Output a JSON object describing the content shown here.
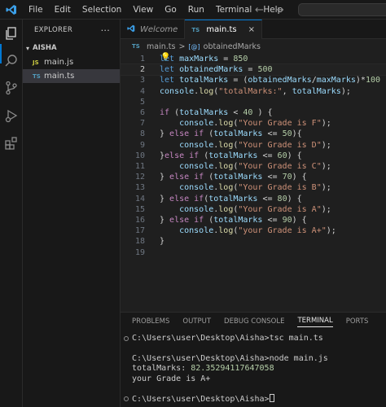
{
  "menu": [
    "File",
    "Edit",
    "Selection",
    "View",
    "Go",
    "Run",
    "Terminal",
    "Help"
  ],
  "nav": {
    "back": "←",
    "forward": "→"
  },
  "explorer": {
    "title": "EXPLORER",
    "more": "···",
    "folder": "AISHA",
    "files": [
      {
        "icon": "JS",
        "icon_color": "#cbcb41",
        "name": "main.js",
        "active": false
      },
      {
        "icon": "TS",
        "icon_color": "#519aba",
        "name": "main.ts",
        "active": true
      }
    ]
  },
  "tabs": [
    {
      "icon": "vscode-icon",
      "label": "Welcome",
      "active": false
    },
    {
      "icon": "TS",
      "label": "main.ts",
      "active": true,
      "close": "×"
    }
  ],
  "breadcrumb": {
    "file_icon": "TS",
    "file": "main.ts",
    "sep": ">",
    "symbol_icon": "[@]",
    "symbol": "obtainedMarks"
  },
  "editor": {
    "current_line": 2,
    "lines": [
      {
        "n": "1",
        "tokens": [
          [
            "kw",
            "let"
          ],
          [
            "pl",
            " "
          ],
          [
            "var",
            "maxMarks"
          ],
          [
            "pl",
            " = "
          ],
          [
            "num",
            "850"
          ]
        ]
      },
      {
        "n": "2",
        "tokens": [
          [
            "kw",
            "let"
          ],
          [
            "pl",
            " "
          ],
          [
            "var",
            "obtainedMarks"
          ],
          [
            "pl",
            " = "
          ],
          [
            "num",
            "500"
          ]
        ]
      },
      {
        "n": "3",
        "tokens": [
          [
            "kw",
            "let"
          ],
          [
            "pl",
            " "
          ],
          [
            "var",
            "totalMarks"
          ],
          [
            "pl",
            " = ("
          ],
          [
            "var",
            "obtainedMarks"
          ],
          [
            "pl",
            "/"
          ],
          [
            "var",
            "maxMarks"
          ],
          [
            "pl",
            ")*"
          ],
          [
            "num",
            "100"
          ]
        ]
      },
      {
        "n": "4",
        "tokens": [
          [
            "var",
            "console"
          ],
          [
            "pl",
            "."
          ],
          [
            "fn",
            "log"
          ],
          [
            "pl",
            "("
          ],
          [
            "str",
            "\"totalMarks:\""
          ],
          [
            "pl",
            ", "
          ],
          [
            "var",
            "totalMarks"
          ],
          [
            "pl",
            ");"
          ]
        ]
      },
      {
        "n": "5",
        "tokens": []
      },
      {
        "n": "6",
        "tokens": [
          [
            "ctl",
            "if"
          ],
          [
            "pl",
            " ("
          ],
          [
            "var",
            "totalMarks"
          ],
          [
            "pl",
            " < "
          ],
          [
            "num",
            "40"
          ],
          [
            "pl",
            " ) {"
          ]
        ]
      },
      {
        "n": "7",
        "tokens": [
          [
            "pl",
            "    "
          ],
          [
            "var",
            "console"
          ],
          [
            "pl",
            "."
          ],
          [
            "fn",
            "log"
          ],
          [
            "pl",
            "("
          ],
          [
            "str",
            "\"Your Grade is F\""
          ],
          [
            "pl",
            ");"
          ]
        ]
      },
      {
        "n": "8",
        "tokens": [
          [
            "pl",
            "} "
          ],
          [
            "ctl",
            "else if"
          ],
          [
            "pl",
            " ("
          ],
          [
            "var",
            "totalMarks"
          ],
          [
            "pl",
            " <= "
          ],
          [
            "num",
            "50"
          ],
          [
            "pl",
            "){"
          ]
        ]
      },
      {
        "n": "9",
        "tokens": [
          [
            "pl",
            "    "
          ],
          [
            "var",
            "console"
          ],
          [
            "pl",
            "."
          ],
          [
            "fn",
            "log"
          ],
          [
            "pl",
            "("
          ],
          [
            "str",
            "\"Your Grade is D\""
          ],
          [
            "pl",
            ");"
          ]
        ]
      },
      {
        "n": "10",
        "tokens": [
          [
            "pl",
            "}"
          ],
          [
            "ctl",
            "else if"
          ],
          [
            "pl",
            " ("
          ],
          [
            "var",
            "totalMarks"
          ],
          [
            "pl",
            " <= "
          ],
          [
            "num",
            "60"
          ],
          [
            "pl",
            ") {"
          ]
        ]
      },
      {
        "n": "11",
        "tokens": [
          [
            "pl",
            "    "
          ],
          [
            "var",
            "console"
          ],
          [
            "pl",
            "."
          ],
          [
            "fn",
            "log"
          ],
          [
            "pl",
            "("
          ],
          [
            "str",
            "\"Your Grade is C\""
          ],
          [
            "pl",
            ");"
          ]
        ]
      },
      {
        "n": "12",
        "tokens": [
          [
            "pl",
            "} "
          ],
          [
            "ctl",
            "else if"
          ],
          [
            "pl",
            " ("
          ],
          [
            "var",
            "totalMarks"
          ],
          [
            "pl",
            " <= "
          ],
          [
            "num",
            "70"
          ],
          [
            "pl",
            ") {"
          ]
        ]
      },
      {
        "n": "13",
        "tokens": [
          [
            "pl",
            "    "
          ],
          [
            "var",
            "console"
          ],
          [
            "pl",
            "."
          ],
          [
            "fn",
            "log"
          ],
          [
            "pl",
            "("
          ],
          [
            "str",
            "\"Your Grade is B\""
          ],
          [
            "pl",
            ");"
          ]
        ]
      },
      {
        "n": "14",
        "tokens": [
          [
            "pl",
            "} "
          ],
          [
            "ctl",
            "else if"
          ],
          [
            "pl",
            "("
          ],
          [
            "var",
            "totalMarks"
          ],
          [
            "pl",
            " <= "
          ],
          [
            "num",
            "80"
          ],
          [
            "pl",
            ") {"
          ]
        ]
      },
      {
        "n": "15",
        "tokens": [
          [
            "pl",
            "    "
          ],
          [
            "var",
            "console"
          ],
          [
            "pl",
            "."
          ],
          [
            "fn",
            "log"
          ],
          [
            "pl",
            "("
          ],
          [
            "str",
            "\"Your Grade is A\""
          ],
          [
            "pl",
            ");"
          ]
        ]
      },
      {
        "n": "16",
        "tokens": [
          [
            "pl",
            "} "
          ],
          [
            "ctl",
            "else if"
          ],
          [
            "pl",
            " ("
          ],
          [
            "var",
            "totalMarks"
          ],
          [
            "pl",
            " <= "
          ],
          [
            "num",
            "90"
          ],
          [
            "pl",
            ") {"
          ]
        ]
      },
      {
        "n": "17",
        "tokens": [
          [
            "pl",
            "    "
          ],
          [
            "var",
            "console"
          ],
          [
            "pl",
            "."
          ],
          [
            "fn",
            "log"
          ],
          [
            "pl",
            "("
          ],
          [
            "str",
            "\"your Grade is A+\""
          ],
          [
            "pl",
            ");"
          ]
        ]
      },
      {
        "n": "18",
        "tokens": [
          [
            "pl",
            "}"
          ]
        ]
      },
      {
        "n": "19",
        "tokens": []
      }
    ]
  },
  "panel": {
    "tabs": [
      {
        "label": "PROBLEMS",
        "active": false
      },
      {
        "label": "OUTPUT",
        "active": false
      },
      {
        "label": "DEBUG CONSOLE",
        "active": false
      },
      {
        "label": "TERMINAL",
        "active": true
      },
      {
        "label": "PORTS",
        "active": false
      }
    ],
    "terminal": [
      {
        "dot": true,
        "text": "C:\\Users\\user\\Desktop\\Aisha>tsc main.ts"
      },
      {
        "dot": false,
        "text": ""
      },
      {
        "dot": false,
        "text": "C:\\Users\\user\\Desktop\\Aisha>node main.js"
      },
      {
        "dot": false,
        "text": "totalMarks: ",
        "num": "82.35294117647058"
      },
      {
        "dot": false,
        "text": "your Grade is A+"
      },
      {
        "dot": false,
        "text": ""
      },
      {
        "dot": true,
        "text": "C:\\Users\\user\\Desktop\\Aisha>",
        "cursor": true
      }
    ]
  }
}
